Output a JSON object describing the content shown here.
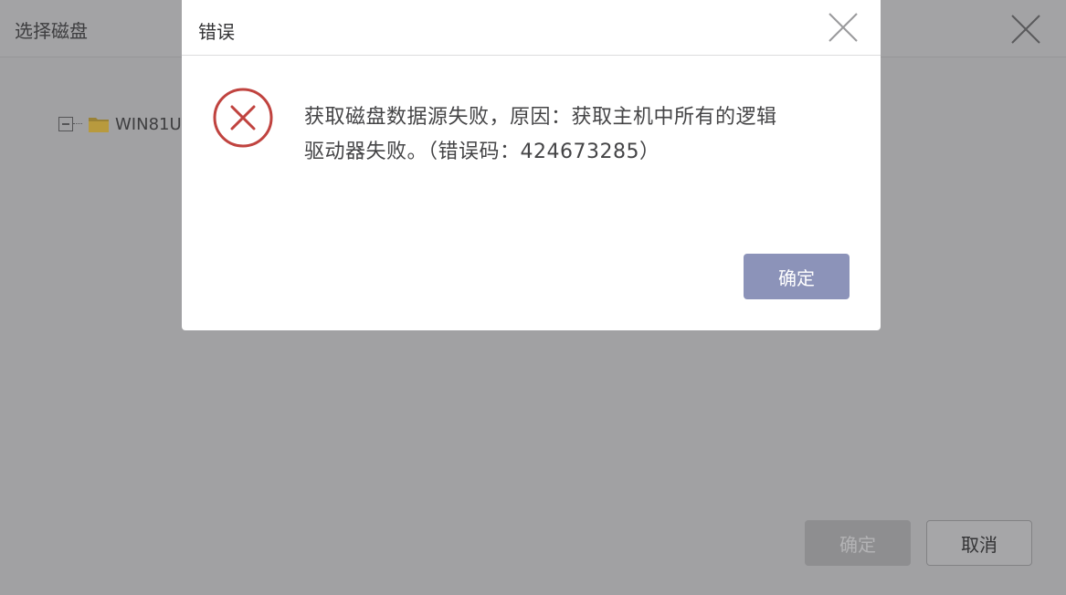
{
  "background_dialog": {
    "title": "选择磁盘",
    "tree": {
      "root_label": "WIN81U"
    },
    "ok_label": "确定",
    "cancel_label": "取消"
  },
  "error_modal": {
    "title": "错误",
    "message_line1": "获取磁盘数据源失败，原因：获取主机中所有的逻辑",
    "message_line2": "驱动器失败。（错误码：424673285）",
    "ok_label": "确定"
  },
  "icons": {
    "close": "close-icon",
    "error": "error-circle-x-icon",
    "folder": "folder-icon",
    "tree_toggle": "tree-collapse-icon"
  },
  "colors": {
    "overlay": "#a1a1a3",
    "error_red": "#c0433f",
    "primary_button": "#8c93b9",
    "folder": "#b89a3e"
  }
}
